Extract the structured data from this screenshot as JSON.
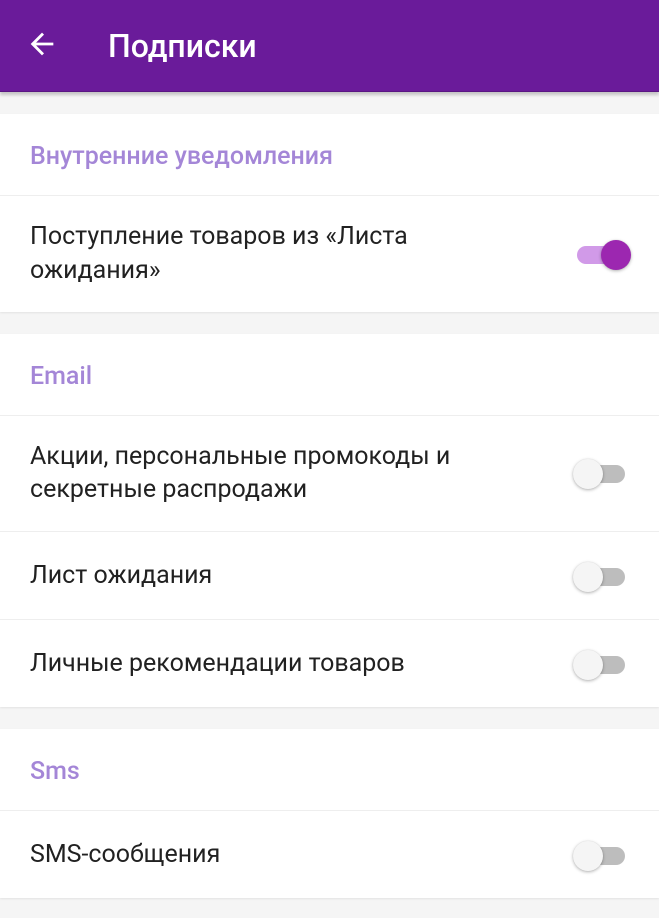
{
  "header": {
    "title": "Подписки"
  },
  "sections": {
    "internal": {
      "title": "Внутренние уведомления",
      "items": [
        {
          "label": "Поступление товаров из «Листа ожидания»",
          "on": true
        }
      ]
    },
    "email": {
      "title": "Email",
      "items": [
        {
          "label": "Акции, персональные промокоды и секретные распродажи",
          "on": false
        },
        {
          "label": "Лист ожидания",
          "on": false
        },
        {
          "label": "Личные рекомендации товаров",
          "on": false
        }
      ]
    },
    "sms": {
      "title": "Sms",
      "items": [
        {
          "label": "SMS-сообщения",
          "on": false
        }
      ]
    }
  }
}
